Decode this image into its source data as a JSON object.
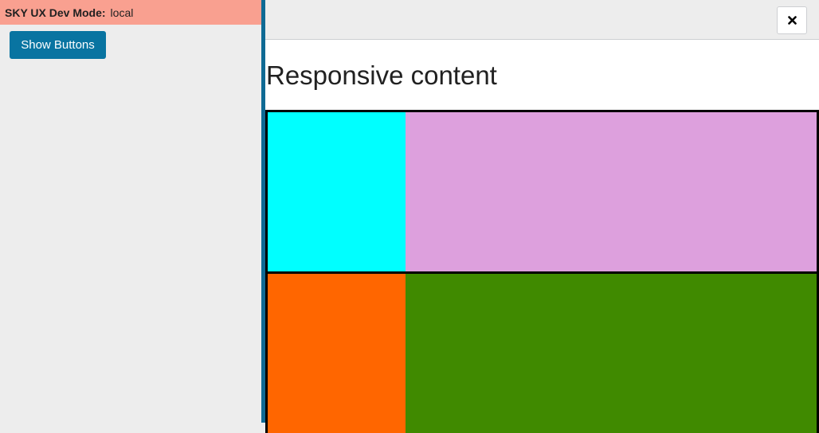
{
  "dev_mode": {
    "label": "SKY UX Dev Mode:",
    "value": "local"
  },
  "sidebar": {
    "show_buttons_label": "Show Buttons"
  },
  "flyout": {
    "close_icon": "close-icon",
    "heading": "Responsive content"
  },
  "colors": {
    "dev_bar": "#f9a090",
    "primary_button": "#0974a1",
    "divider": "#0f6a94",
    "row1_left": "#00ffff",
    "row1_right": "#dda0dd",
    "row2_left": "#ff6600",
    "row2_right": "#408a00"
  }
}
